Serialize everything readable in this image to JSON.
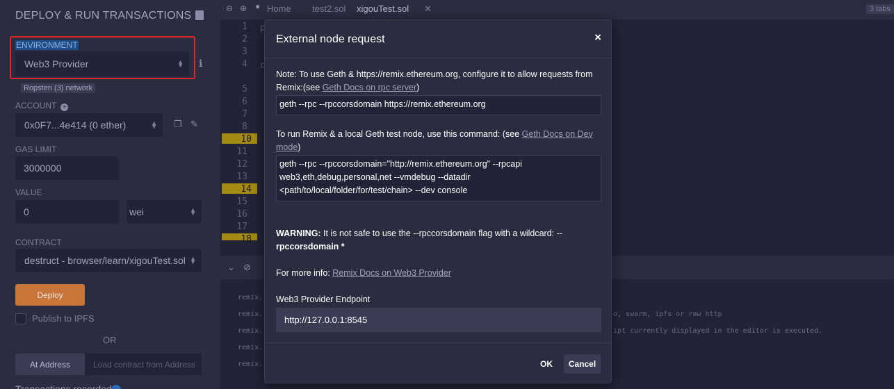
{
  "panel": {
    "title": "DEPLOY & RUN TRANSACTIONS",
    "environment_label": "ENVIRONMENT",
    "environment_value": "Web3 Provider",
    "network_badge": "Ropsten (3) network",
    "account_label": "ACCOUNT",
    "account_value": "0x0F7...4e414 (0 ether)",
    "gas_limit_label": "GAS LIMIT",
    "gas_limit_value": "3000000",
    "value_label": "VALUE",
    "value_amount": "0",
    "value_unit": "wei",
    "contract_label": "CONTRACT",
    "contract_value": "destruct - browser/learn/xigouTest.sol",
    "deploy_label": "Deploy",
    "publish_label": "Publish to IPFS",
    "or_label": "OR",
    "at_address_label": "At Address",
    "at_address_placeholder": "Load contract from Address"
  },
  "editor": {
    "tabs": [
      "Home",
      "test2.sol",
      "xigouTest.sol"
    ],
    "active_tab": "xigouTest.sol",
    "tabs_count": "3 tabs",
    "line_numbers": [
      "1",
      "2",
      "3",
      "4",
      "5",
      "6",
      "7",
      "8",
      "9",
      "10",
      "11",
      "12",
      "13",
      "14",
      "15",
      "16",
      "17",
      "18"
    ],
    "breakpoint_lines": [
      "10",
      "14",
      "18"
    ],
    "code_fragments": [
      "p",
      "c"
    ]
  },
  "terminal": {
    "lines": [
      "remix.",
      "remix.",
      "remix.",
      "remix.",
      "remix."
    ],
    "overflow_lines": [
      "o, swarm, ipfs or raw http",
      "ipt currently displayed in the editor is executed."
    ]
  },
  "modal": {
    "title": "External node request",
    "close_glyph": "×",
    "note_text": "Note: To use Geth & https://remix.ethereum.org, configure it to allow requests from Remix:(see ",
    "note_link": "Geth Docs on rpc server",
    "note_tail": ")",
    "cmd1": "geth --rpc --rpccorsdomain https://remix.ethereum.org",
    "run_text": "To run Remix & a local Geth test node, use this command: (see ",
    "run_link": "Geth Docs on Dev mode",
    "run_tail": ")",
    "cmd2": "geth --rpc --rpccorsdomain=\"http://remix.ethereum.org\" --rpcapi web3,eth,debug,personal,net --vmdebug --datadir <path/to/local/folder/for/test/chain> --dev console",
    "warning_label": "WARNING:",
    "warning_text": " It is not safe to use the --rpccorsdomain flag with a wildcard: --",
    "warning_bold_tail": "rpccorsdomain *",
    "more_info_text": "For more info: ",
    "more_info_link": "Remix Docs on Web3 Provider",
    "endpoint_label": "Web3 Provider Endpoint",
    "endpoint_value": "http://127.0.0.1:8545",
    "ok_label": "OK",
    "cancel_label": "Cancel"
  }
}
